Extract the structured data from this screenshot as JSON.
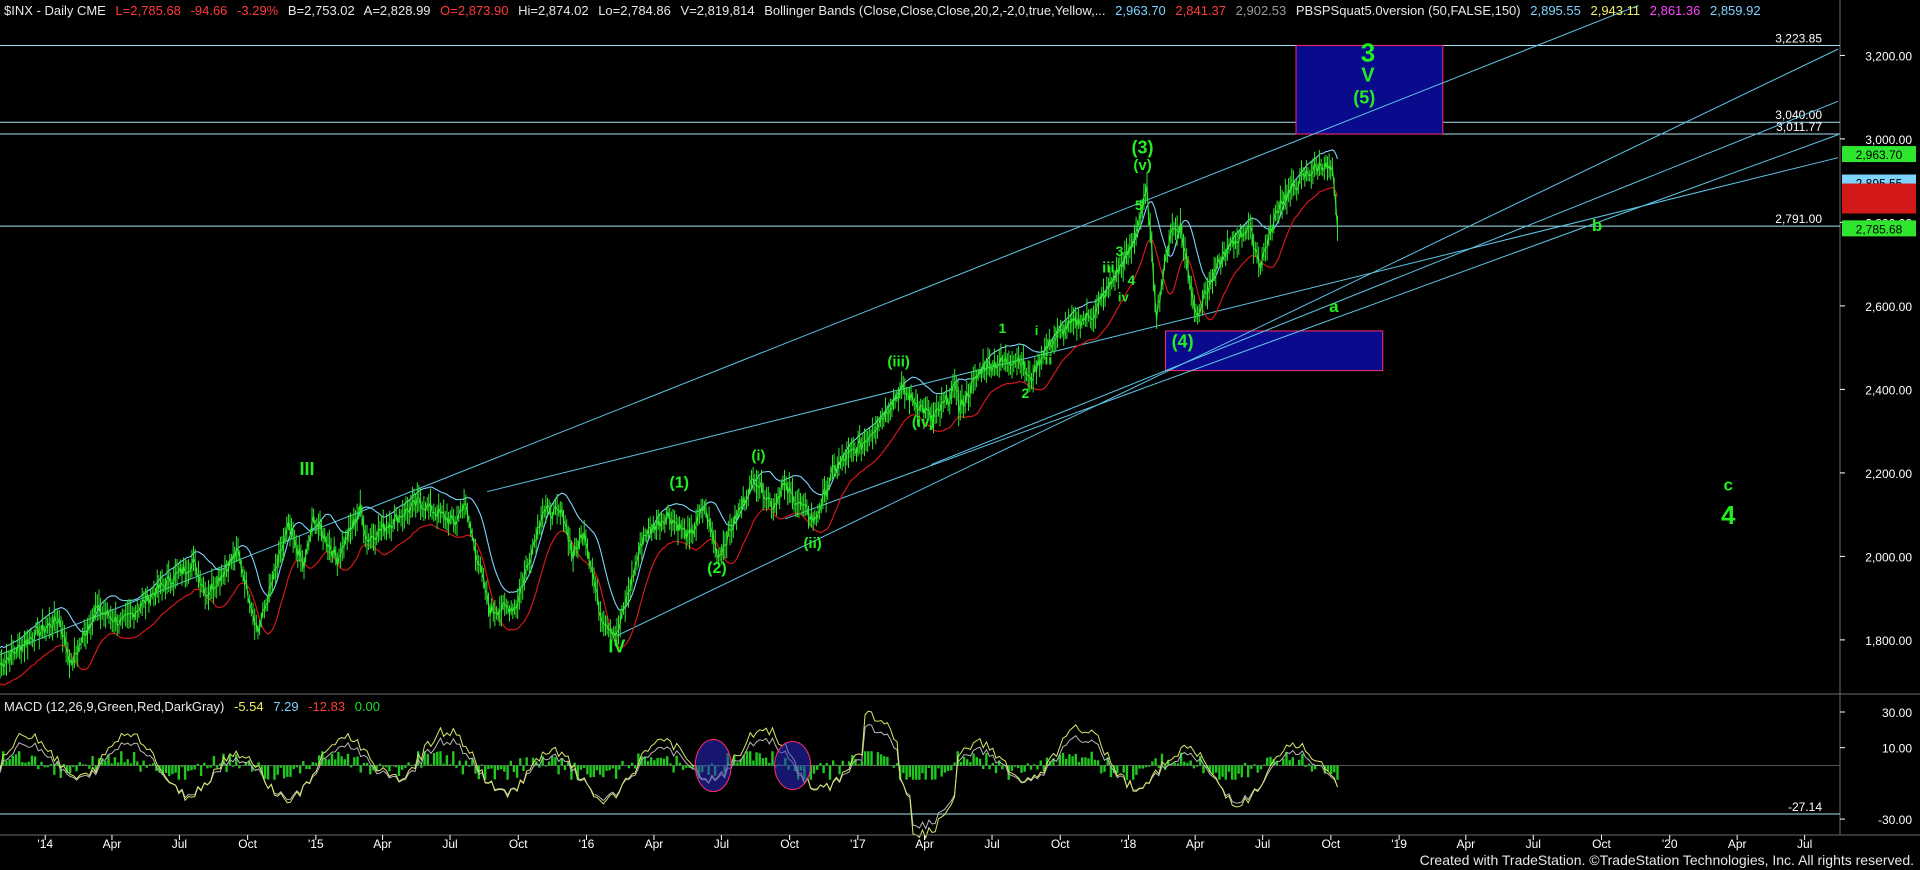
{
  "header": {
    "symbol": "$INX - Daily  CME",
    "last": "L=2,785.68",
    "change": "-94.66",
    "change_pct": "-3.29%",
    "bid": "B=2,753.02",
    "ask": "A=2,828.99",
    "open": "O=2,873.90",
    "high": "Hi=2,874.02",
    "low": "Lo=2,784.86",
    "volume": "V=2,819,814",
    "bb_study": "Bollinger Bands (Close,Close,Close,20,2,-2,0,true,Yellow,...",
    "bb_v1": "2,963.70",
    "bb_v2": "2,841.37",
    "bb_v3": "2,902.53",
    "pbs_study": "PBSPSquat5.0version (50,FALSE,150)",
    "pbs_v1": "2,895.55",
    "pbs_v2": "2,943.11",
    "pbs_v3": "2,861.36",
    "pbs_v4": "2,859.92"
  },
  "macd_header": {
    "study": "MACD (12,26,9,Green,Red,DarkGray)",
    "v1": "-5.54",
    "v2": "7.29",
    "v3": "-12.83",
    "v4": "0.00"
  },
  "footer": "Created with TradeStation. ©TradeStation Technologies, Inc. All rights reserved.",
  "colors": {
    "background": "#000000",
    "price": "#2ee62e",
    "bb_upper": "#7fd4ff",
    "bb_lower": "#d21818",
    "channel": "#5fc6e6",
    "hline": "#a9dff0",
    "box_fill": "#0a0a8c",
    "box_border": "#ff2d6e",
    "wave_label": "#22ee22",
    "macd_pos": "#22dd22",
    "macd_neg": "#ee1111",
    "macd_line": "#d8e86a",
    "signal_line": "#b7b7b7",
    "axis_text": "#ffffff"
  },
  "chart_data": {
    "type": "line",
    "title": "$INX - Daily  CME",
    "x_range": [
      "2013-11-01",
      "2020-08-15"
    ],
    "ylim": [
      1680,
      3280
    ],
    "y_ticks": [
      "1,800.00",
      "2,000.00",
      "2,200.00",
      "2,400.00",
      "2,600.00",
      "2,800.00",
      "3,000.00",
      "3,200.00"
    ],
    "y_tick_values": [
      1800,
      2000,
      2200,
      2400,
      2600,
      2800,
      3000,
      3200
    ],
    "x_ticks": [
      "'14",
      "Apr",
      "Jul",
      "Oct",
      "'15",
      "Apr",
      "Jul",
      "Oct",
      "'16",
      "Apr",
      "Jul",
      "Oct",
      "'17",
      "Apr",
      "Jul",
      "Oct",
      "'18",
      "Apr",
      "Jul",
      "Oct",
      "'19",
      "Apr",
      "Jul",
      "Oct",
      "'20",
      "Apr",
      "Jul"
    ],
    "x_tick_dates": [
      "2014-01-01",
      "2014-04-01",
      "2014-07-01",
      "2014-10-01",
      "2015-01-01",
      "2015-04-01",
      "2015-07-01",
      "2015-10-01",
      "2016-01-01",
      "2016-04-01",
      "2016-07-01",
      "2016-10-01",
      "2017-01-01",
      "2017-04-01",
      "2017-07-01",
      "2017-10-01",
      "2018-01-01",
      "2018-04-01",
      "2018-07-01",
      "2018-10-01",
      "2019-01-01",
      "2019-04-01",
      "2019-07-01",
      "2019-10-01",
      "2020-01-01",
      "2020-04-01",
      "2020-07-01"
    ],
    "series": [
      {
        "x": [
          "2013-11-01",
          "2013-12-15",
          "2014-01-20",
          "2014-02-05",
          "2014-03-10",
          "2014-04-15",
          "2014-06-01",
          "2014-07-20",
          "2014-08-07",
          "2014-09-18",
          "2014-10-15",
          "2014-11-25",
          "2014-12-16",
          "2014-12-29",
          "2015-01-30",
          "2015-03-02",
          "2015-03-11",
          "2015-05-20",
          "2015-07-08",
          "2015-07-20",
          "2015-08-24",
          "2015-09-28",
          "2015-11-03",
          "2015-12-01",
          "2015-12-14",
          "2015-12-29",
          "2016-01-20",
          "2016-02-11",
          "2016-03-18",
          "2016-04-20",
          "2016-05-19",
          "2016-06-08",
          "2016-06-27",
          "2016-08-15",
          "2016-09-09",
          "2016-09-22",
          "2016-11-04",
          "2016-11-30",
          "2017-01-10",
          "2017-03-01",
          "2017-04-13",
          "2017-05-16",
          "2017-05-17",
          "2017-06-19",
          "2017-08-08",
          "2017-08-21",
          "2017-09-10",
          "2017-10-10",
          "2017-11-15",
          "2018-01-05",
          "2018-01-26",
          "2018-02-08",
          "2018-02-27",
          "2018-03-12",
          "2018-04-02",
          "2018-05-10",
          "2018-06-12",
          "2018-06-28",
          "2018-07-25",
          "2018-08-29",
          "2018-09-20",
          "2018-10-03",
          "2018-10-10"
        ],
        "y": [
          1740,
          1810,
          1850,
          1740,
          1875,
          1840,
          1920,
          1985,
          1910,
          2010,
          1820,
          2070,
          1975,
          2090,
          1995,
          2115,
          2040,
          2130,
          2080,
          2130,
          1870,
          1880,
          2110,
          2100,
          2000,
          2065,
          1860,
          1810,
          2050,
          2100,
          2045,
          2120,
          2000,
          2190,
          2120,
          2170,
          2085,
          2210,
          2275,
          2400,
          2330,
          2410,
          2350,
          2455,
          2475,
          2420,
          2495,
          2550,
          2580,
          2740,
          2875,
          2580,
          2780,
          2790,
          2580,
          2725,
          2790,
          2700,
          2850,
          2915,
          2940,
          2920,
          2786
        ],
        "name": "$INX"
      }
    ],
    "hlines": [
      {
        "value": 3223.85,
        "label": "3,223.85"
      },
      {
        "value": 3040.0,
        "label": "3,040.00"
      },
      {
        "value": 3011.77,
        "label": "3,011.77"
      },
      {
        "value": 2791.0,
        "label": "2,791.00"
      }
    ],
    "value_boxes": [
      "2,963.70",
      "2,895.55",
      "2,785.68"
    ],
    "macd_axis": [
      "30.00",
      "10.00",
      "-30.00"
    ],
    "macd_axis_values": [
      30,
      10,
      -30
    ],
    "macd_hline_label": "-27.14",
    "macd_hline_value": -27.14,
    "wave_labels": [
      "III",
      "IV",
      "(1)",
      "(2)",
      "(i)",
      "(ii)",
      "(iii)",
      "(iv)",
      "(3)",
      "(v)",
      "(4)",
      "3",
      "V",
      "(5)",
      "a",
      "b",
      "c",
      "4",
      "1",
      "2",
      "i",
      "ii",
      "iii",
      "iv",
      "3",
      "4",
      "5"
    ]
  }
}
